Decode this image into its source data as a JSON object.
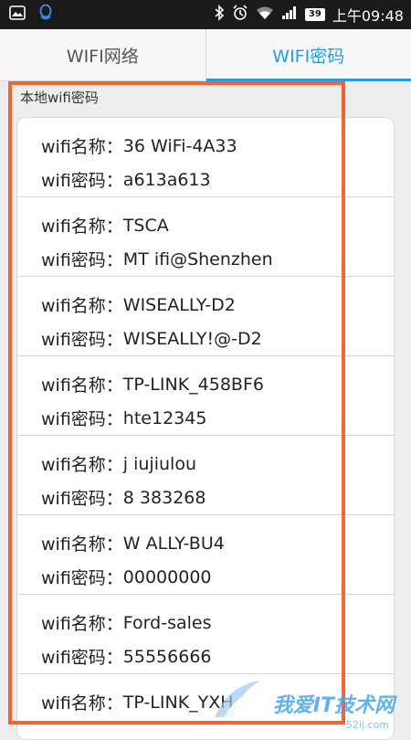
{
  "status_bar": {
    "time": "上午09:48",
    "battery": "39",
    "icons": [
      "image-icon",
      "qq-icon",
      "bluetooth-icon",
      "alarm-icon",
      "wifi-icon",
      "signal-icon",
      "battery-icon"
    ]
  },
  "tabs": [
    {
      "label": "WIFI网络",
      "active": false
    },
    {
      "label": "WIFI密码",
      "active": true
    }
  ],
  "section_label": "本地wifi密码",
  "field_labels": {
    "name": "wifi名称：",
    "password": "wifi密码："
  },
  "entries": [
    {
      "name": "36  WiFi-4A33",
      "password": "a613a613"
    },
    {
      "name": "  TSCA",
      "password": "MT  ifi@Shenzhen"
    },
    {
      "name": "WISEALLY-D2",
      "password": "WISEALLY!@-D2"
    },
    {
      "name": "TP-LINK_458BF6",
      "password": "hte12345"
    },
    {
      "name": "j   iujiulou",
      "password": "8  383268"
    },
    {
      "name": "W   ALLY-BU4",
      "password": "00000000"
    },
    {
      "name": "Ford-sales",
      "password": "55556666"
    },
    {
      "name": "TP-LINK_YXH",
      "password": ""
    }
  ],
  "colors": {
    "accent": "#2a9ae0",
    "highlight": "#f0643c"
  },
  "watermark": {
    "text": "我爱IT技术网",
    "sub": "52ij.com"
  }
}
